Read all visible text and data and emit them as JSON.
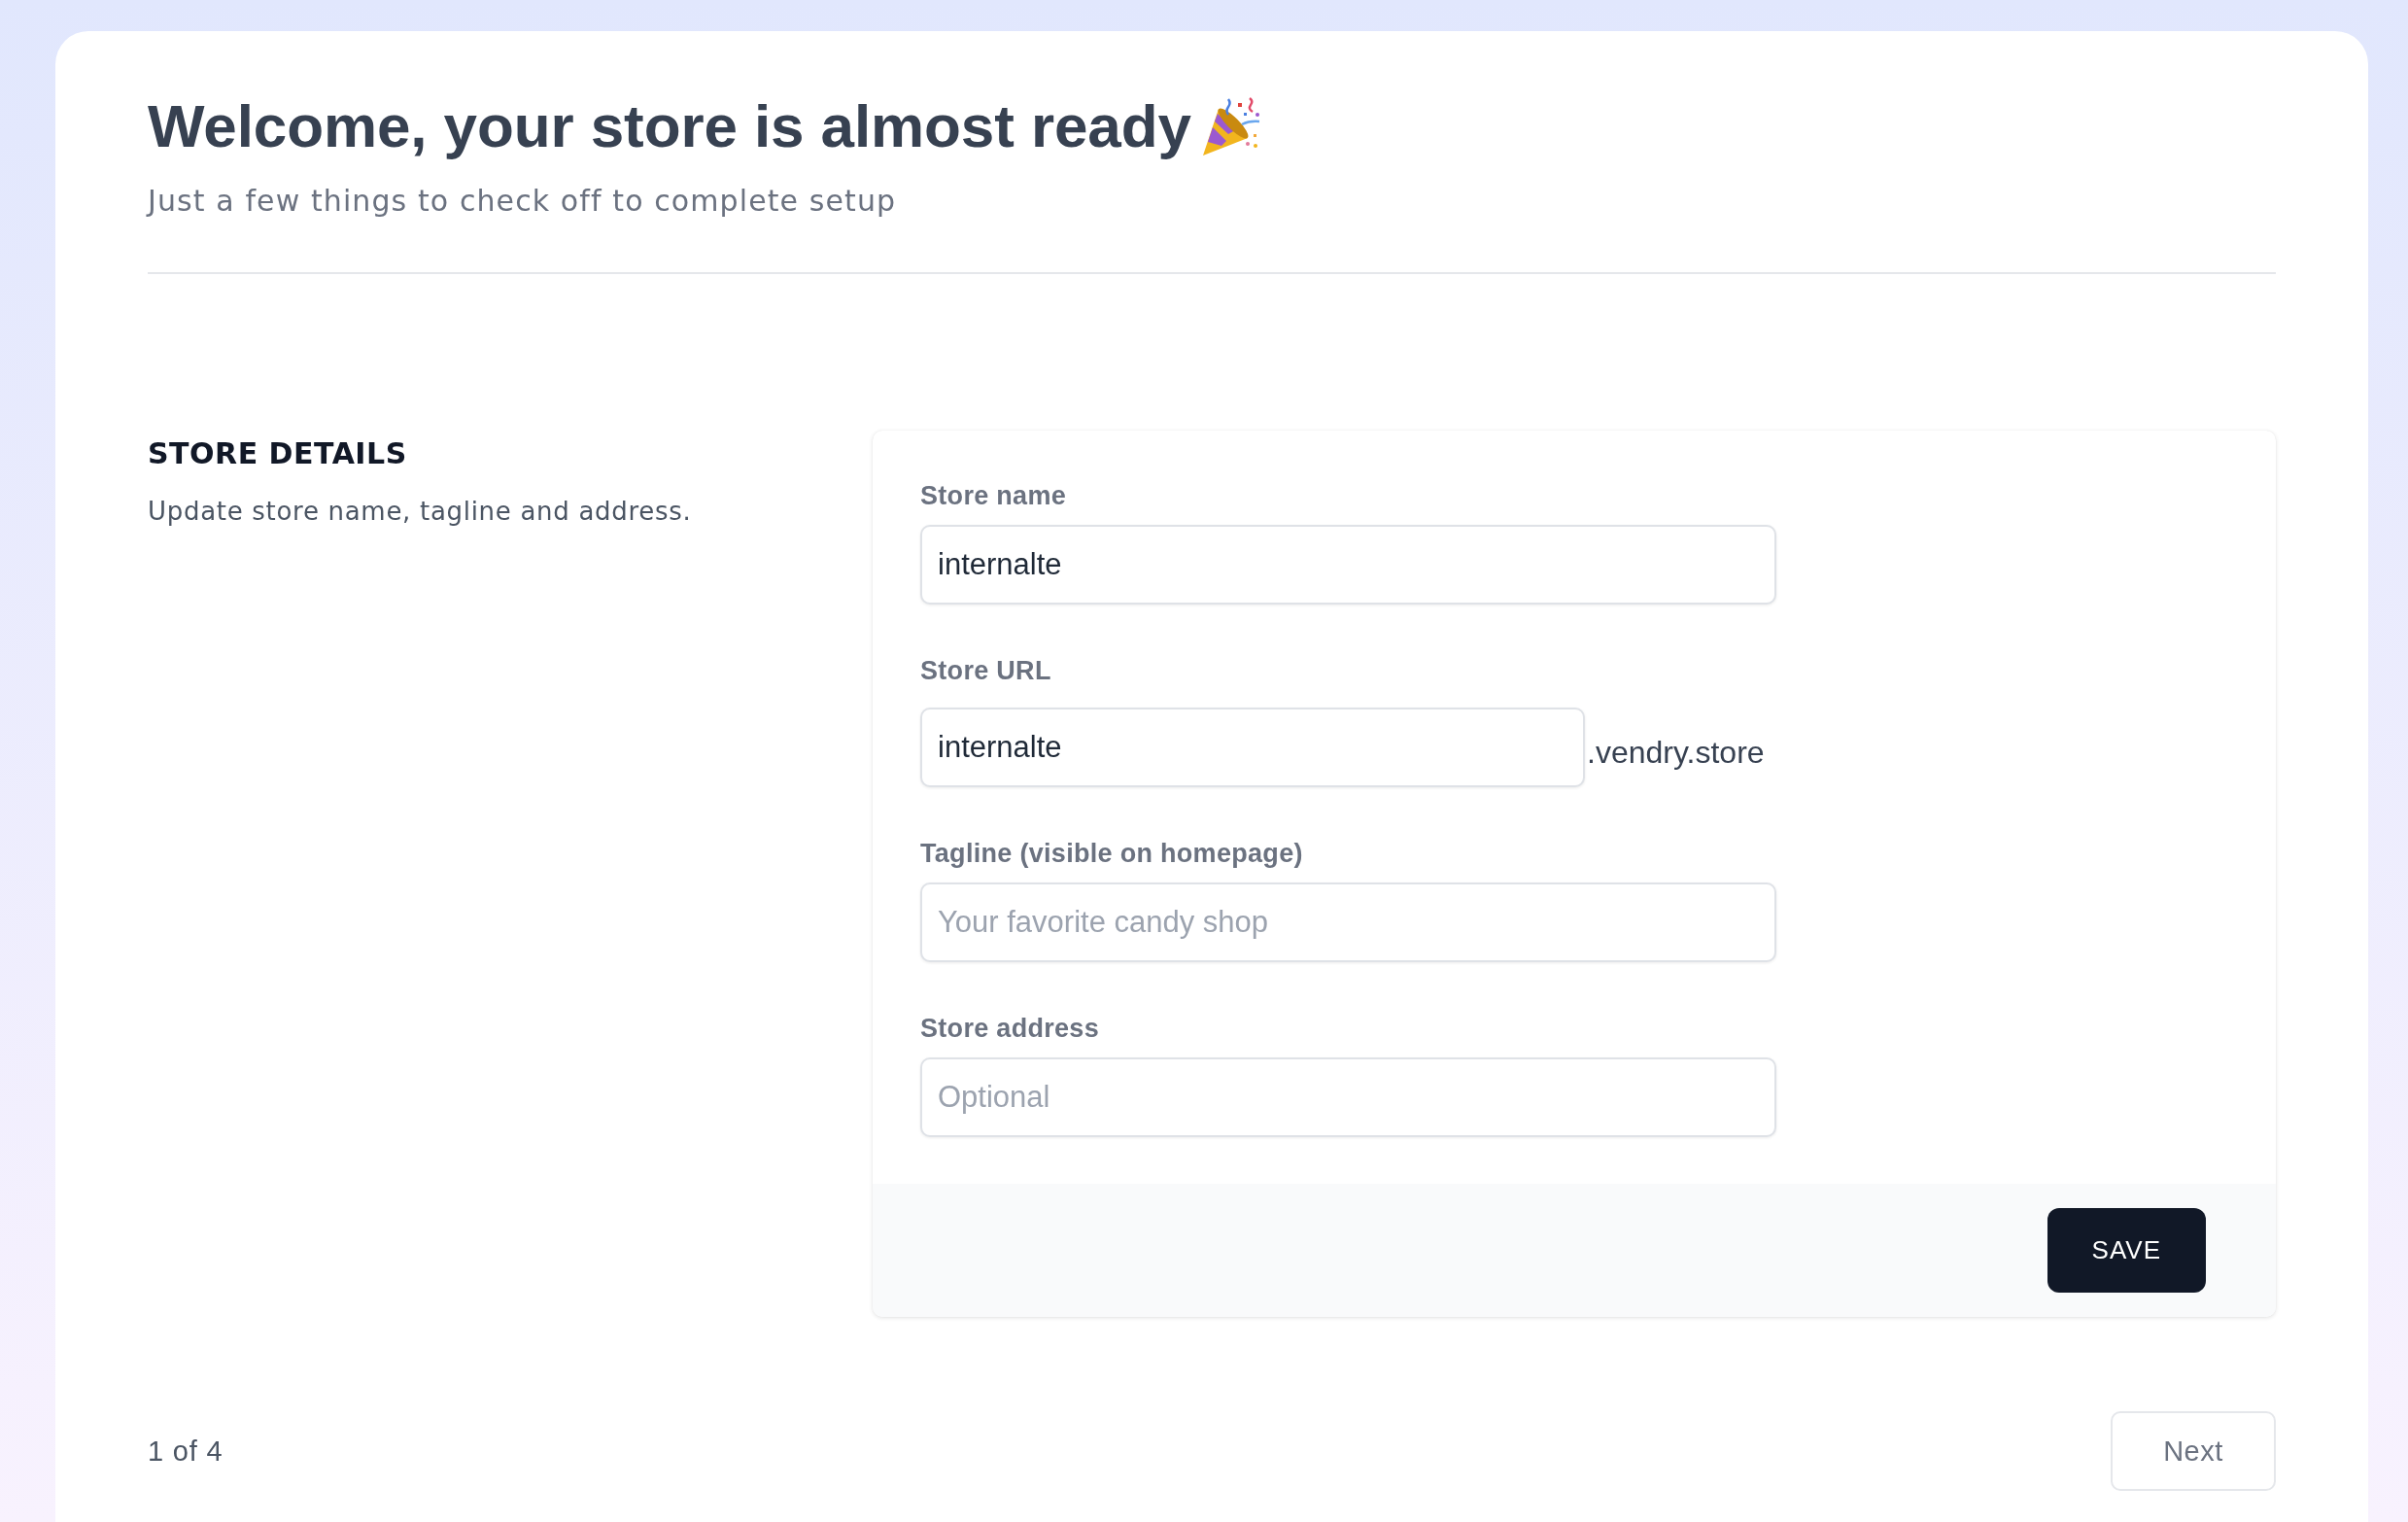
{
  "header": {
    "title": "Welcome, your store is almost ready",
    "subtitle": "Just a few things to check off to complete setup"
  },
  "section": {
    "heading": "STORE DETAILS",
    "description": "Update store name, tagline and address."
  },
  "form": {
    "fields": [
      {
        "kind": "text",
        "label": "Store name",
        "value": "internalte"
      },
      {
        "kind": "url",
        "label": "Store URL",
        "value": "internalte",
        "suffix": ".vendry.store"
      },
      {
        "kind": "text",
        "label": "Tagline (visible on homepage)",
        "placeholder": "Your favorite candy shop"
      },
      {
        "kind": "text",
        "label": "Store address",
        "placeholder": "Optional"
      }
    ],
    "save_button": "SAVE"
  },
  "footer": {
    "step": "1 of 4",
    "next_button": "Next"
  }
}
